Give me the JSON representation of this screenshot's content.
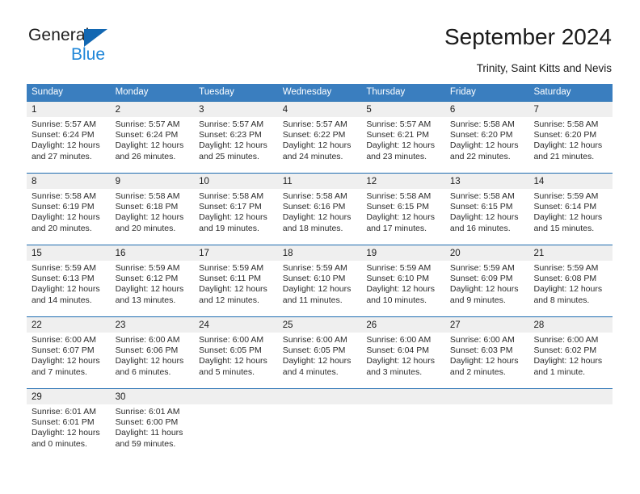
{
  "brand": {
    "name_part1": "General",
    "name_part2": "Blue"
  },
  "header": {
    "title": "September 2024",
    "subtitle": "Trinity, Saint Kitts and Nevis"
  },
  "colors": {
    "header_blue": "#3a7ebf",
    "row_divider_blue": "#1f6cb0",
    "day_band_gray": "#efefef",
    "logo_blue": "#1267b2",
    "logo_text_blue": "#1f86d8"
  },
  "weekdays": [
    "Sunday",
    "Monday",
    "Tuesday",
    "Wednesday",
    "Thursday",
    "Friday",
    "Saturday"
  ],
  "weeks": [
    [
      {
        "day": "1",
        "sunrise": "Sunrise: 5:57 AM",
        "sunset": "Sunset: 6:24 PM",
        "daylight1": "Daylight: 12 hours",
        "daylight2": "and 27 minutes."
      },
      {
        "day": "2",
        "sunrise": "Sunrise: 5:57 AM",
        "sunset": "Sunset: 6:24 PM",
        "daylight1": "Daylight: 12 hours",
        "daylight2": "and 26 minutes."
      },
      {
        "day": "3",
        "sunrise": "Sunrise: 5:57 AM",
        "sunset": "Sunset: 6:23 PM",
        "daylight1": "Daylight: 12 hours",
        "daylight2": "and 25 minutes."
      },
      {
        "day": "4",
        "sunrise": "Sunrise: 5:57 AM",
        "sunset": "Sunset: 6:22 PM",
        "daylight1": "Daylight: 12 hours",
        "daylight2": "and 24 minutes."
      },
      {
        "day": "5",
        "sunrise": "Sunrise: 5:57 AM",
        "sunset": "Sunset: 6:21 PM",
        "daylight1": "Daylight: 12 hours",
        "daylight2": "and 23 minutes."
      },
      {
        "day": "6",
        "sunrise": "Sunrise: 5:58 AM",
        "sunset": "Sunset: 6:20 PM",
        "daylight1": "Daylight: 12 hours",
        "daylight2": "and 22 minutes."
      },
      {
        "day": "7",
        "sunrise": "Sunrise: 5:58 AM",
        "sunset": "Sunset: 6:20 PM",
        "daylight1": "Daylight: 12 hours",
        "daylight2": "and 21 minutes."
      }
    ],
    [
      {
        "day": "8",
        "sunrise": "Sunrise: 5:58 AM",
        "sunset": "Sunset: 6:19 PM",
        "daylight1": "Daylight: 12 hours",
        "daylight2": "and 20 minutes."
      },
      {
        "day": "9",
        "sunrise": "Sunrise: 5:58 AM",
        "sunset": "Sunset: 6:18 PM",
        "daylight1": "Daylight: 12 hours",
        "daylight2": "and 20 minutes."
      },
      {
        "day": "10",
        "sunrise": "Sunrise: 5:58 AM",
        "sunset": "Sunset: 6:17 PM",
        "daylight1": "Daylight: 12 hours",
        "daylight2": "and 19 minutes."
      },
      {
        "day": "11",
        "sunrise": "Sunrise: 5:58 AM",
        "sunset": "Sunset: 6:16 PM",
        "daylight1": "Daylight: 12 hours",
        "daylight2": "and 18 minutes."
      },
      {
        "day": "12",
        "sunrise": "Sunrise: 5:58 AM",
        "sunset": "Sunset: 6:15 PM",
        "daylight1": "Daylight: 12 hours",
        "daylight2": "and 17 minutes."
      },
      {
        "day": "13",
        "sunrise": "Sunrise: 5:58 AM",
        "sunset": "Sunset: 6:15 PM",
        "daylight1": "Daylight: 12 hours",
        "daylight2": "and 16 minutes."
      },
      {
        "day": "14",
        "sunrise": "Sunrise: 5:59 AM",
        "sunset": "Sunset: 6:14 PM",
        "daylight1": "Daylight: 12 hours",
        "daylight2": "and 15 minutes."
      }
    ],
    [
      {
        "day": "15",
        "sunrise": "Sunrise: 5:59 AM",
        "sunset": "Sunset: 6:13 PM",
        "daylight1": "Daylight: 12 hours",
        "daylight2": "and 14 minutes."
      },
      {
        "day": "16",
        "sunrise": "Sunrise: 5:59 AM",
        "sunset": "Sunset: 6:12 PM",
        "daylight1": "Daylight: 12 hours",
        "daylight2": "and 13 minutes."
      },
      {
        "day": "17",
        "sunrise": "Sunrise: 5:59 AM",
        "sunset": "Sunset: 6:11 PM",
        "daylight1": "Daylight: 12 hours",
        "daylight2": "and 12 minutes."
      },
      {
        "day": "18",
        "sunrise": "Sunrise: 5:59 AM",
        "sunset": "Sunset: 6:10 PM",
        "daylight1": "Daylight: 12 hours",
        "daylight2": "and 11 minutes."
      },
      {
        "day": "19",
        "sunrise": "Sunrise: 5:59 AM",
        "sunset": "Sunset: 6:10 PM",
        "daylight1": "Daylight: 12 hours",
        "daylight2": "and 10 minutes."
      },
      {
        "day": "20",
        "sunrise": "Sunrise: 5:59 AM",
        "sunset": "Sunset: 6:09 PM",
        "daylight1": "Daylight: 12 hours",
        "daylight2": "and 9 minutes."
      },
      {
        "day": "21",
        "sunrise": "Sunrise: 5:59 AM",
        "sunset": "Sunset: 6:08 PM",
        "daylight1": "Daylight: 12 hours",
        "daylight2": "and 8 minutes."
      }
    ],
    [
      {
        "day": "22",
        "sunrise": "Sunrise: 6:00 AM",
        "sunset": "Sunset: 6:07 PM",
        "daylight1": "Daylight: 12 hours",
        "daylight2": "and 7 minutes."
      },
      {
        "day": "23",
        "sunrise": "Sunrise: 6:00 AM",
        "sunset": "Sunset: 6:06 PM",
        "daylight1": "Daylight: 12 hours",
        "daylight2": "and 6 minutes."
      },
      {
        "day": "24",
        "sunrise": "Sunrise: 6:00 AM",
        "sunset": "Sunset: 6:05 PM",
        "daylight1": "Daylight: 12 hours",
        "daylight2": "and 5 minutes."
      },
      {
        "day": "25",
        "sunrise": "Sunrise: 6:00 AM",
        "sunset": "Sunset: 6:05 PM",
        "daylight1": "Daylight: 12 hours",
        "daylight2": "and 4 minutes."
      },
      {
        "day": "26",
        "sunrise": "Sunrise: 6:00 AM",
        "sunset": "Sunset: 6:04 PM",
        "daylight1": "Daylight: 12 hours",
        "daylight2": "and 3 minutes."
      },
      {
        "day": "27",
        "sunrise": "Sunrise: 6:00 AM",
        "sunset": "Sunset: 6:03 PM",
        "daylight1": "Daylight: 12 hours",
        "daylight2": "and 2 minutes."
      },
      {
        "day": "28",
        "sunrise": "Sunrise: 6:00 AM",
        "sunset": "Sunset: 6:02 PM",
        "daylight1": "Daylight: 12 hours",
        "daylight2": "and 1 minute."
      }
    ],
    [
      {
        "day": "29",
        "sunrise": "Sunrise: 6:01 AM",
        "sunset": "Sunset: 6:01 PM",
        "daylight1": "Daylight: 12 hours",
        "daylight2": "and 0 minutes."
      },
      {
        "day": "30",
        "sunrise": "Sunrise: 6:01 AM",
        "sunset": "Sunset: 6:00 PM",
        "daylight1": "Daylight: 11 hours",
        "daylight2": "and 59 minutes."
      },
      {
        "day": "",
        "sunrise": "",
        "sunset": "",
        "daylight1": "",
        "daylight2": ""
      },
      {
        "day": "",
        "sunrise": "",
        "sunset": "",
        "daylight1": "",
        "daylight2": ""
      },
      {
        "day": "",
        "sunrise": "",
        "sunset": "",
        "daylight1": "",
        "daylight2": ""
      },
      {
        "day": "",
        "sunrise": "",
        "sunset": "",
        "daylight1": "",
        "daylight2": ""
      },
      {
        "day": "",
        "sunrise": "",
        "sunset": "",
        "daylight1": "",
        "daylight2": ""
      }
    ]
  ]
}
